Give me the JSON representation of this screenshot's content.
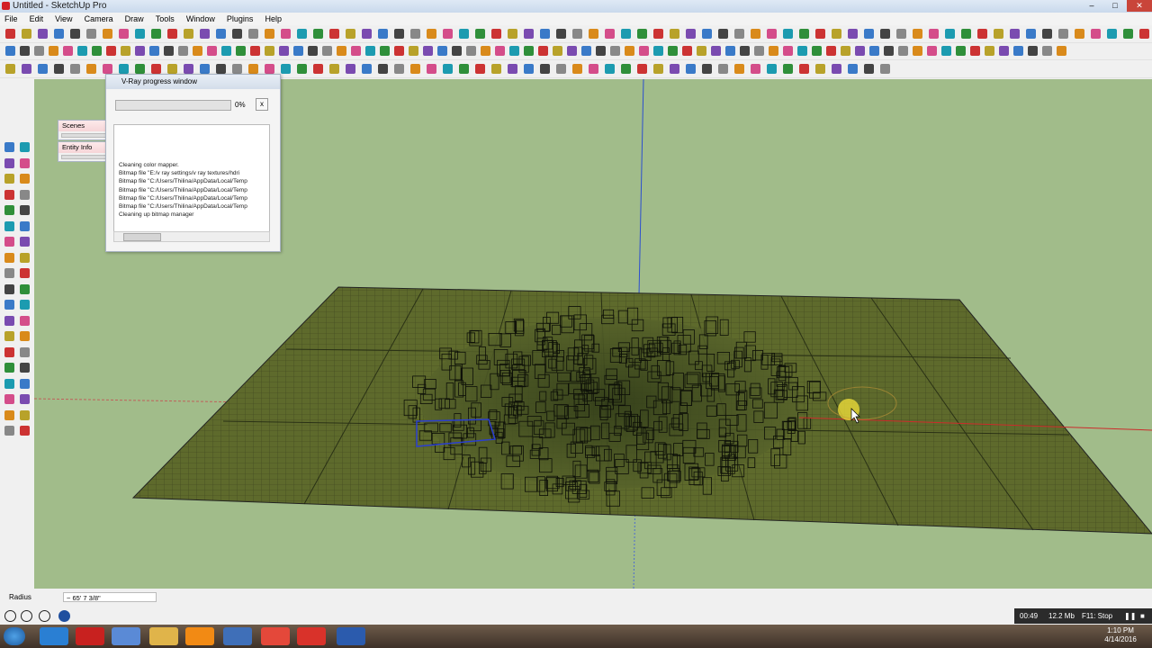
{
  "window": {
    "title": "Untitled - SketchUp Pro",
    "minimize": "–",
    "maximize": "□",
    "close": "✕"
  },
  "menu": [
    "File",
    "Edit",
    "View",
    "Camera",
    "Draw",
    "Tools",
    "Window",
    "Plugins",
    "Help"
  ],
  "vray": {
    "title": "V-Ray progress window",
    "percent": "0%",
    "cancel": "x",
    "log": [
      "Cleaning color mapper.",
      "Bitmap file \"E:/v ray settings/v ray textures/hdri",
      "Bitmap file \"C:/Users/Thilina/AppData/Local/Temp",
      "Bitmap file \"C:/Users/Thilina/AppData/Local/Temp",
      "Bitmap file \"C:/Users/Thilina/AppData/Local/Temp",
      "Bitmap file \"C:/Users/Thilina/AppData/Local/Temp",
      "Cleaning up bitmap manager"
    ]
  },
  "panels": {
    "scenes": "Scenes",
    "entity_info": "Entity Info",
    "close": "x"
  },
  "status": {
    "measure_label": "Radius",
    "measure_value": "~ 65' 7 3/8\""
  },
  "video": {
    "time": "00:49",
    "size": "12.2 Mb",
    "hint": "F11: Stop"
  },
  "clock": {
    "time": "1:10 PM",
    "date": "4/14/2016"
  },
  "colors": {
    "viewport_bg": "#a1bc8a",
    "terrain": "#5e6a2c",
    "axis_red": "#cc2b2b",
    "axis_green": "#3a9a4a",
    "axis_blue": "#2c4fcf"
  }
}
